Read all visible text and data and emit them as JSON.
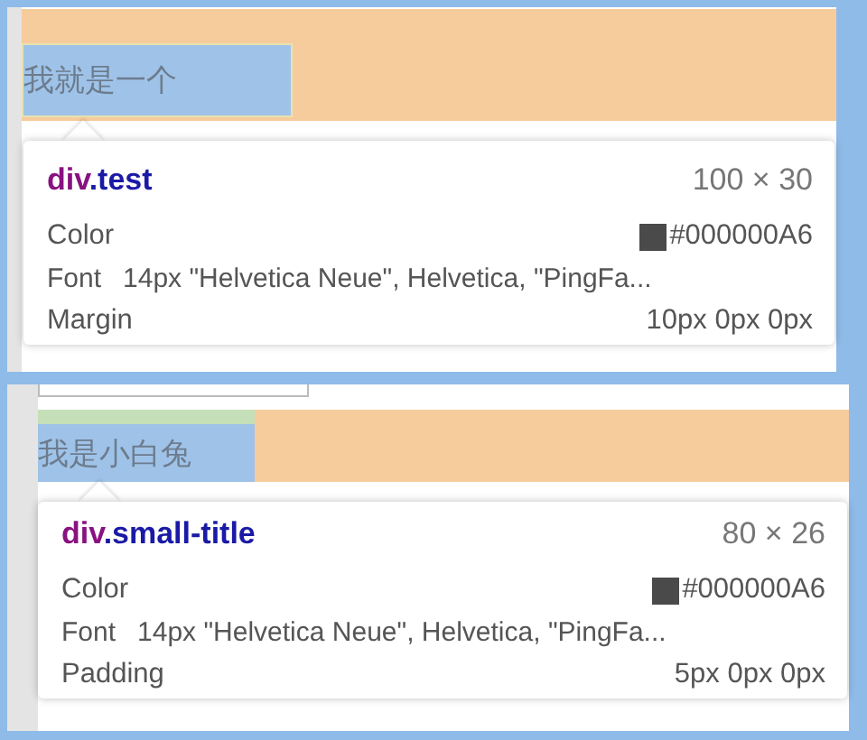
{
  "panels": [
    {
      "element_text": "我就是一个",
      "tag": "div",
      "class_name": ".test",
      "size": "100 × 30",
      "rows": [
        {
          "kind": "plain",
          "label": "Color",
          "value": "#000000A6",
          "swatch": true
        },
        {
          "kind": "font",
          "label": "Font",
          "value": "14px \"Helvetica Neue\", Helvetica, \"PingFa..."
        },
        {
          "kind": "plain",
          "label": "Margin",
          "value": "10px 0px 0px",
          "swatch": false
        }
      ]
    },
    {
      "element_text": "我是小白兔",
      "tag": "div",
      "class_name": ".small-title",
      "size": "80 × 26",
      "rows": [
        {
          "kind": "plain",
          "label": "Color",
          "value": "#000000A6",
          "swatch": true
        },
        {
          "kind": "font",
          "label": "Font",
          "value": "14px \"Helvetica Neue\", Helvetica, \"PingFa..."
        },
        {
          "kind": "plain",
          "label": "Padding",
          "value": "5px 0px 0px",
          "swatch": false
        }
      ]
    }
  ]
}
